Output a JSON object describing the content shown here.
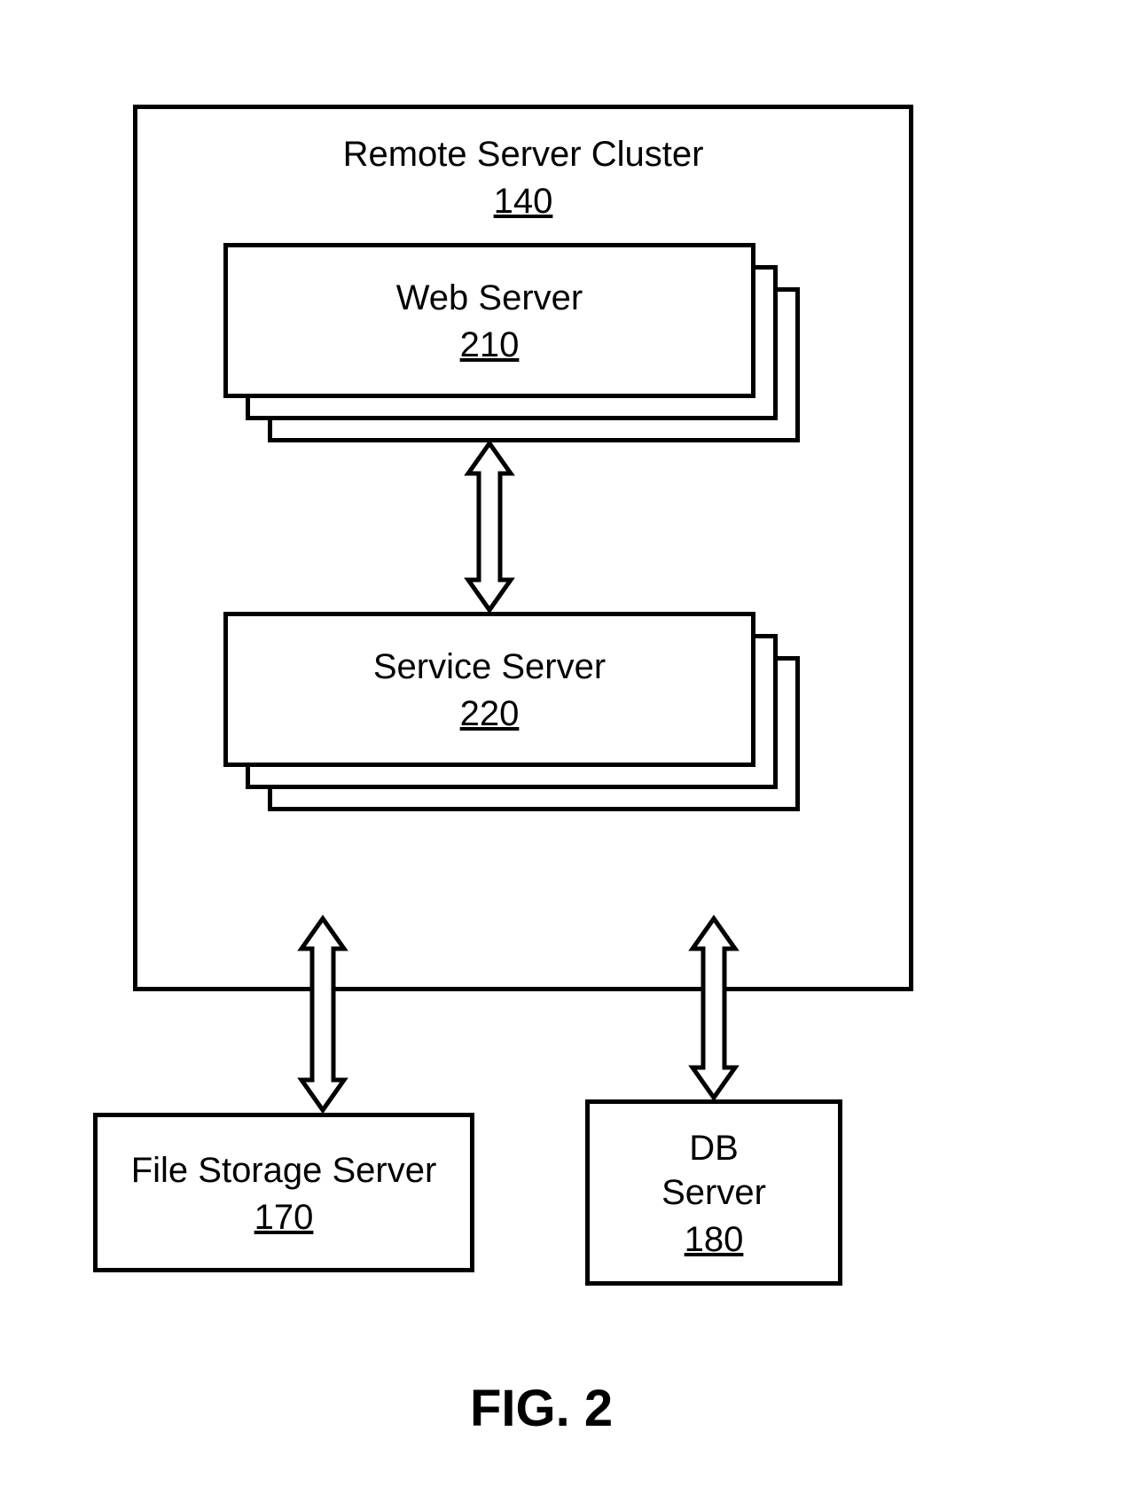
{
  "figure_label": "FIG. 2",
  "cluster": {
    "title": "Remote Server Cluster",
    "ref": "140"
  },
  "web_server": {
    "title": "Web Server",
    "ref": "210"
  },
  "service_server": {
    "title": "Service Server",
    "ref": "220"
  },
  "file_storage": {
    "title": "File Storage Server",
    "ref": "170"
  },
  "db_server": {
    "title_line1": "DB",
    "title_line2": "Server",
    "ref": "180"
  }
}
